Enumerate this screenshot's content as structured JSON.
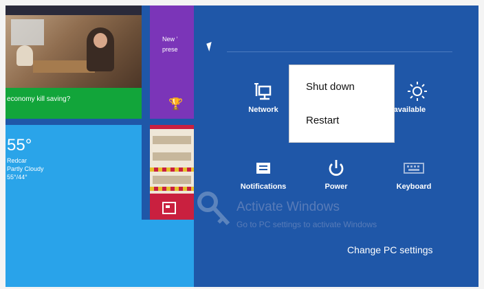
{
  "tiles": {
    "news_headline": "economy kill saving?",
    "news_purple": [
      "New ’",
      "prese"
    ],
    "weather": {
      "temp": "55°",
      "city": "Redcar",
      "condition": "Partly Cloudy",
      "range": "55°/44°"
    }
  },
  "settings": {
    "quick_settings": [
      {
        "label": "Network",
        "icon": "network-icon"
      },
      {
        "label": "Unavailable",
        "icon": "brightness-icon"
      },
      {
        "label": "Notifications",
        "icon": "notifications-icon"
      },
      {
        "label": "Power",
        "icon": "power-icon"
      },
      {
        "label": "Keyboard",
        "icon": "keyboard-icon"
      }
    ],
    "power_menu": [
      "Shut down",
      "Restart"
    ],
    "change_pc_settings": "Change PC settings"
  },
  "watermark": {
    "title": "Activate Windows",
    "subtitle": "Go to PC settings to activate Windows"
  },
  "colors": {
    "pane": "#1f57a8",
    "weather_tile": "#2aa4e9",
    "news_tile": "#7b35b8",
    "store_tile": "#c9203f",
    "headline_tile": "#12a53a"
  }
}
